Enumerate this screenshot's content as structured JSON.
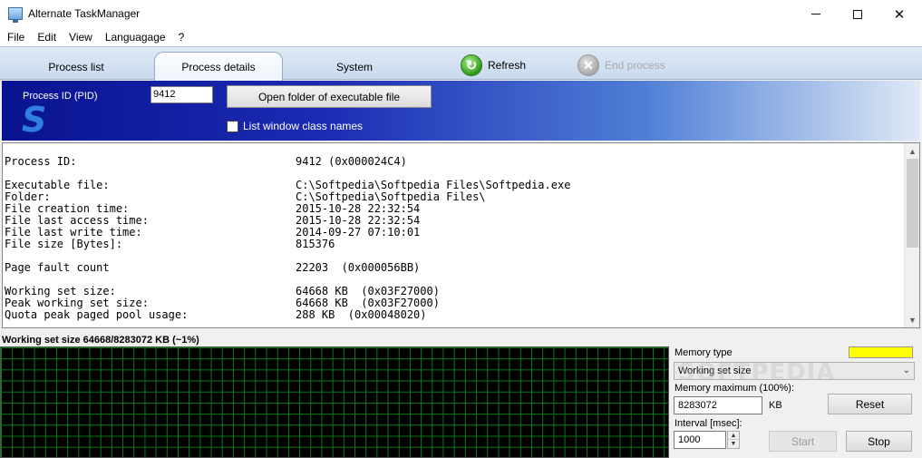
{
  "window": {
    "title": "Alternate TaskManager"
  },
  "menu": [
    "File",
    "Edit",
    "View",
    "Languagage",
    "?"
  ],
  "tabs": {
    "process_list": "Process list",
    "process_details": "Process details",
    "system": "System"
  },
  "toolbar": {
    "refresh": "Refresh",
    "end_process": "End process"
  },
  "header": {
    "pid_label": "Process ID (PID)",
    "pid_value": "9412",
    "open_folder_button": "Open folder of executable file",
    "list_window_class_names": "List window class names",
    "list_window_class_names_checked": false,
    "logo_letter": "S"
  },
  "details": [
    {
      "key": "Process ID:",
      "value": "9412 (0x000024C4)"
    },
    {
      "key": "",
      "value": ""
    },
    {
      "key": "Executable file:",
      "value": "C:\\Softpedia\\Softpedia Files\\Softpedia.exe"
    },
    {
      "key": "Folder:",
      "value": "C:\\Softpedia\\Softpedia Files\\"
    },
    {
      "key": "File creation time:",
      "value": "2015-10-28 22:32:54"
    },
    {
      "key": "File last access time:",
      "value": "2015-10-28 22:32:54"
    },
    {
      "key": "File last write time:",
      "value": "2014-09-27 07:10:01"
    },
    {
      "key": "File size [Bytes]:",
      "value": "815376"
    },
    {
      "key": "",
      "value": ""
    },
    {
      "key": "Page fault count",
      "value": "22203  (0x000056BB)"
    },
    {
      "key": "",
      "value": ""
    },
    {
      "key": "Working set size:",
      "value": "64668 KB  (0x03F27000)"
    },
    {
      "key": "Peak working set size:",
      "value": "64668 KB  (0x03F27000)"
    },
    {
      "key": "Quota peak paged pool usage:",
      "value": "288 KB  (0x00048020)"
    }
  ],
  "graph": {
    "label": "Working set size 64668/8283072 KB (~1%)"
  },
  "memory_panel": {
    "memory_type_label": "Memory type",
    "memory_type_color": "#ffff00",
    "memory_type_value": "Working set size",
    "watermark": "SOFTPEDIA",
    "memory_max_label": "Memory maximum (100%):",
    "memory_max_value": "8283072",
    "memory_max_unit": "KB",
    "reset_button": "Reset",
    "interval_label": "Interval [msec]:",
    "interval_value": "1000",
    "start_button": "Start",
    "stop_button": "Stop"
  }
}
